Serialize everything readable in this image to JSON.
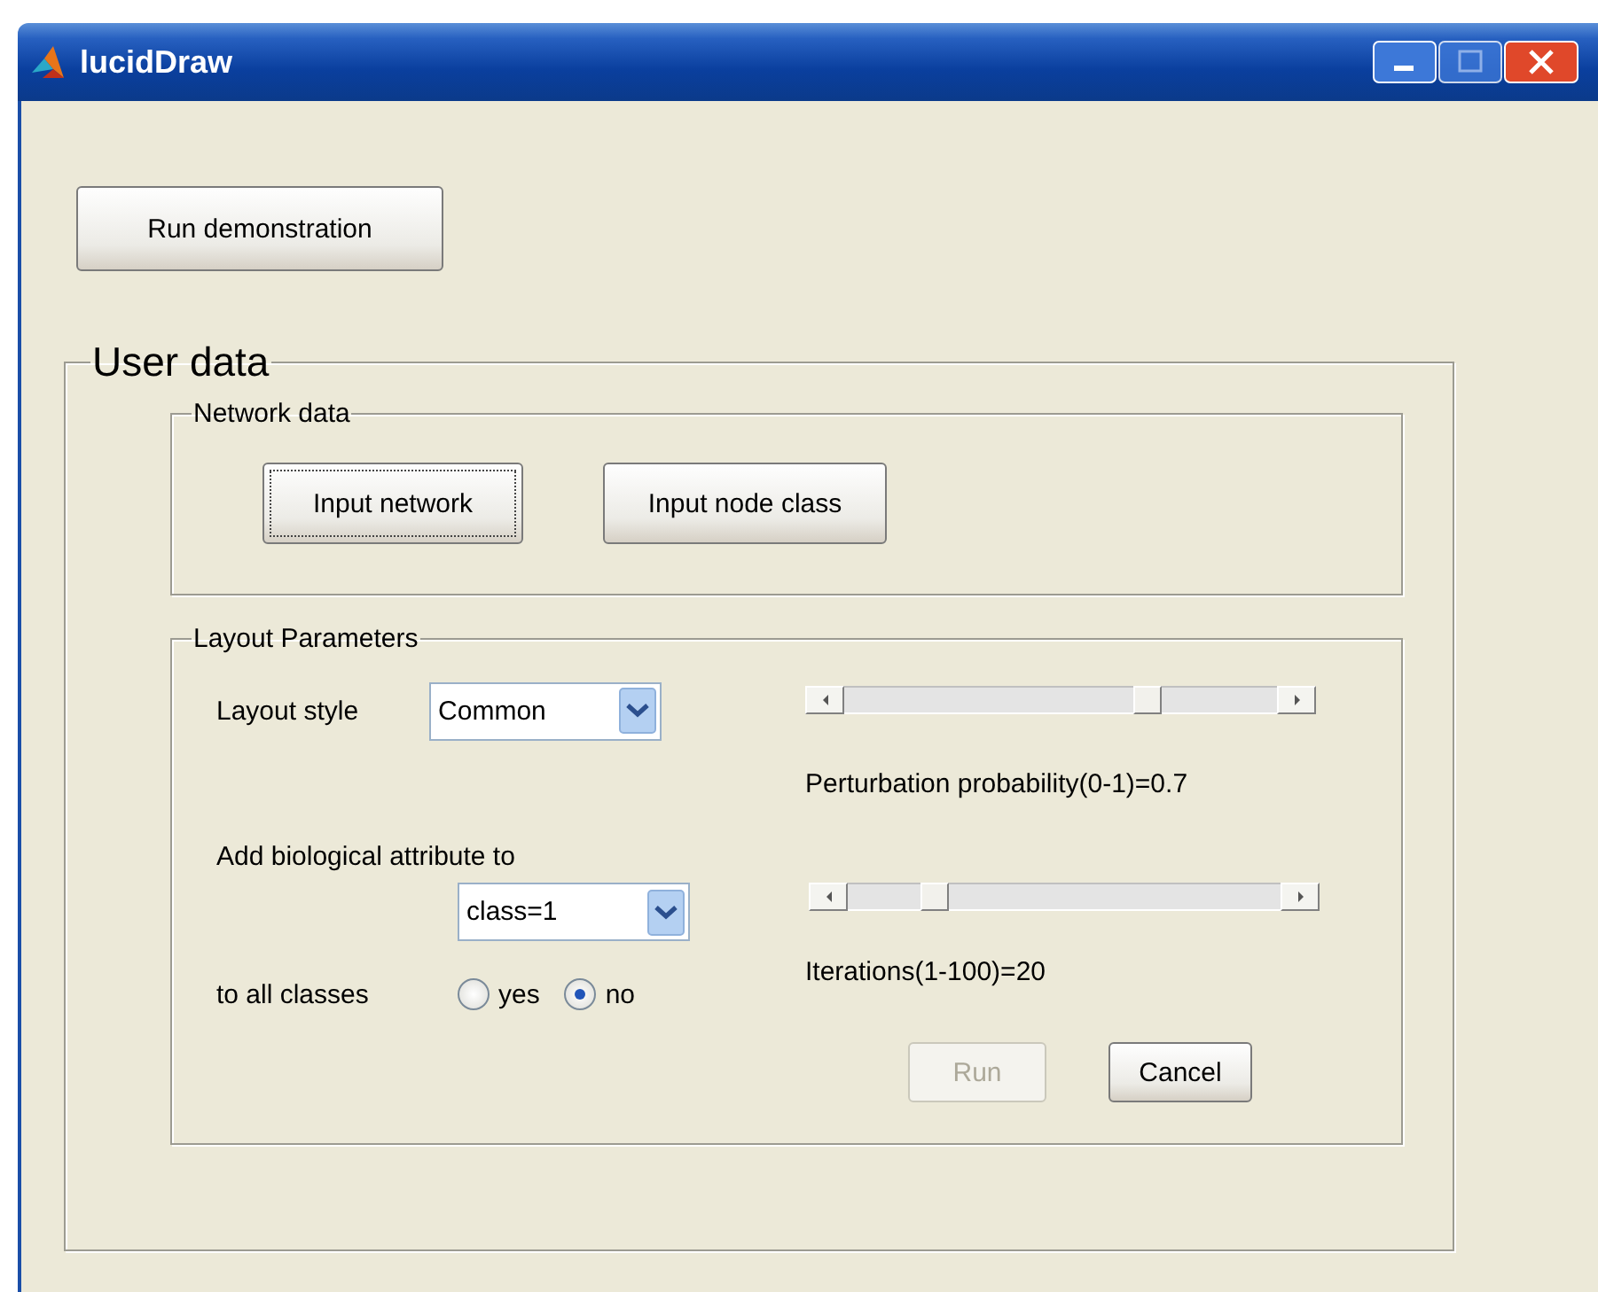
{
  "window": {
    "title": "lucidDraw"
  },
  "demo_button": {
    "label": "Run demonstration"
  },
  "user_data": {
    "title": "User data",
    "network_data": {
      "title": "Network data",
      "buttons": [
        {
          "label": "Input network",
          "focused": true
        },
        {
          "label": "Input node class",
          "focused": false
        }
      ]
    },
    "layout_parameters": {
      "title": "Layout Parameters",
      "layout_style": {
        "label": "Layout style",
        "value": "Common"
      },
      "perturbation": {
        "level": 0.7,
        "reading": "Perturbation probability(0-1)=0.7"
      },
      "attribute": {
        "label": "Add biological attribute to",
        "value": "class=1"
      },
      "iterations": {
        "level": 0.2,
        "reading": "Iterations(1-100)=20"
      },
      "all_classes": {
        "label": "to all classes",
        "options": [
          {
            "label": "yes",
            "selected": false
          },
          {
            "label": "no",
            "selected": true
          }
        ]
      },
      "buttons": [
        {
          "label": "Run",
          "disabled": true
        },
        {
          "label": "Cancel",
          "disabled": false
        }
      ]
    }
  }
}
